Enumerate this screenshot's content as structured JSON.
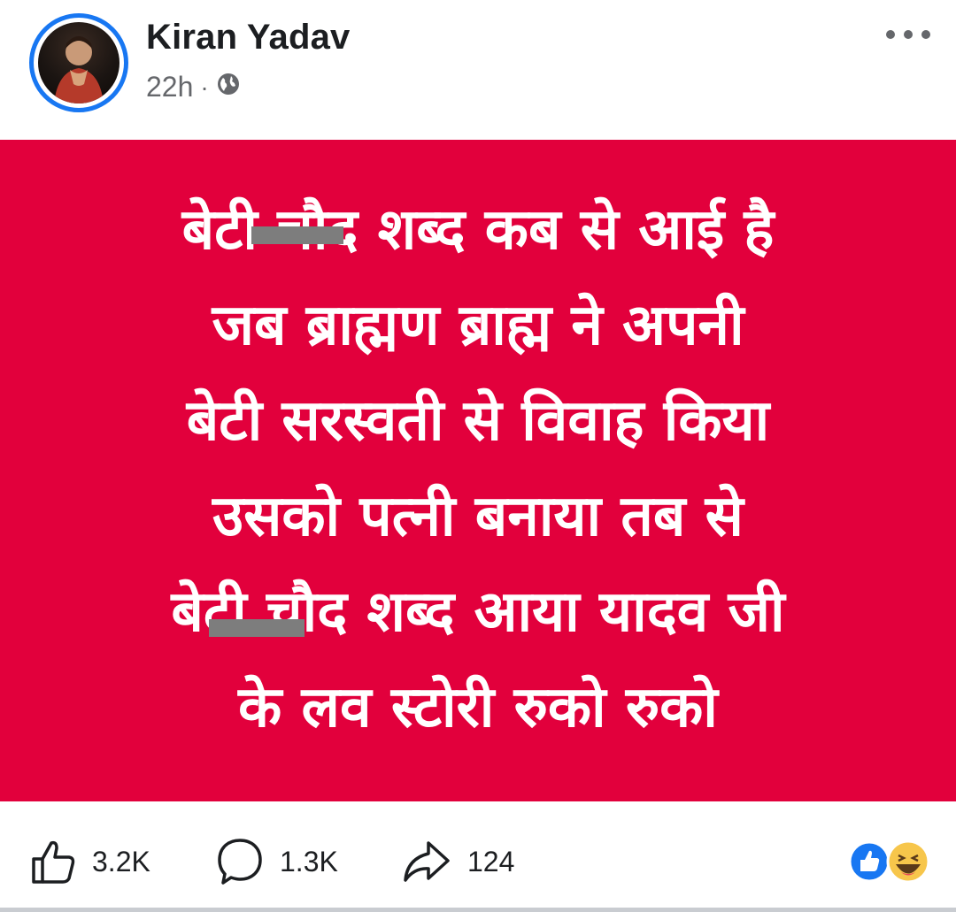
{
  "post": {
    "author": "Kiran Yadav",
    "time": "22h",
    "separator": "·",
    "privacy_icon": "globe-icon",
    "more_icon": "ellipsis-icon",
    "image": {
      "background": "#e2003c",
      "text_color": "#ffffff",
      "lines": [
        "बेटी चौद शब्द कब से आई है",
        "जब ब्राह्मण ब्राह्म ने अपनी",
        "बेटी सरस्वती से विवाह किया",
        "उसको पत्नी बनाया तब से",
        "बेटी चौद शब्द आया यादव जी",
        "के लव स्टोरी रुको रुको"
      ]
    }
  },
  "actions": {
    "like": {
      "icon": "thumbs-up-icon",
      "count": "3.2K"
    },
    "comment": {
      "icon": "comment-icon",
      "count": "1.3K"
    },
    "share": {
      "icon": "share-arrow-icon",
      "count": "124"
    },
    "reactions": [
      "like-reaction-icon",
      "haha-reaction-icon"
    ]
  }
}
